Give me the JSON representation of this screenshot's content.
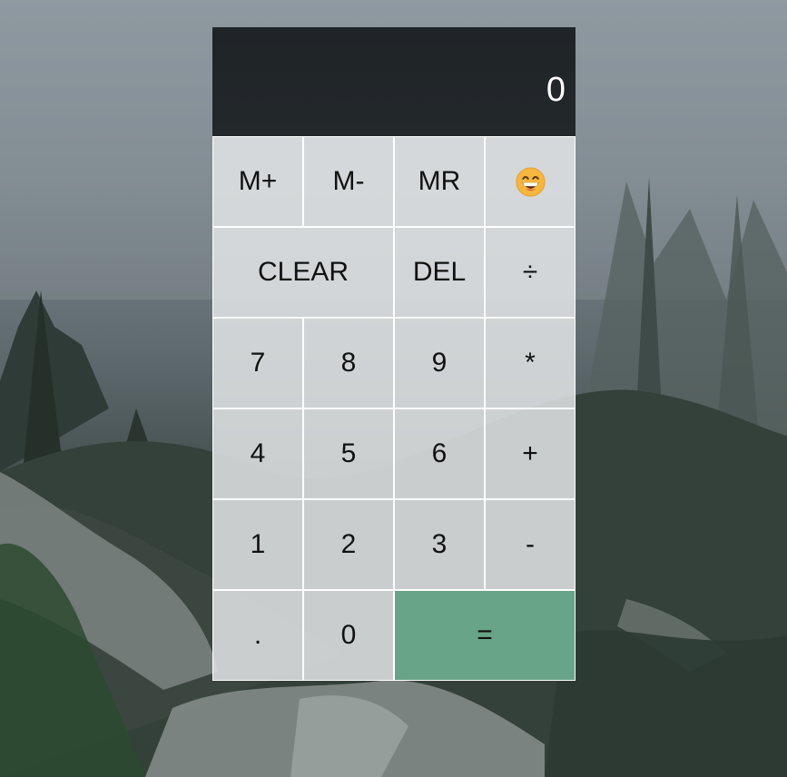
{
  "display": {
    "value": "0"
  },
  "keys": {
    "m_plus": "M+",
    "m_minus": "M-",
    "mr": "MR",
    "emoji_icon": "grinning-face-icon",
    "clear": "CLEAR",
    "del": "DEL",
    "divide": "÷",
    "seven": "7",
    "eight": "8",
    "nine": "9",
    "multiply": "*",
    "four": "4",
    "five": "5",
    "six": "6",
    "plus": "+",
    "one": "1",
    "two": "2",
    "three": "3",
    "minus": "-",
    "decimal": ".",
    "zero": "0",
    "equals": "="
  },
  "colors": {
    "display_bg": "#1f2427",
    "key_bg": "#e2e4e5",
    "equals_bg": "#67a488",
    "text": "#111111"
  }
}
